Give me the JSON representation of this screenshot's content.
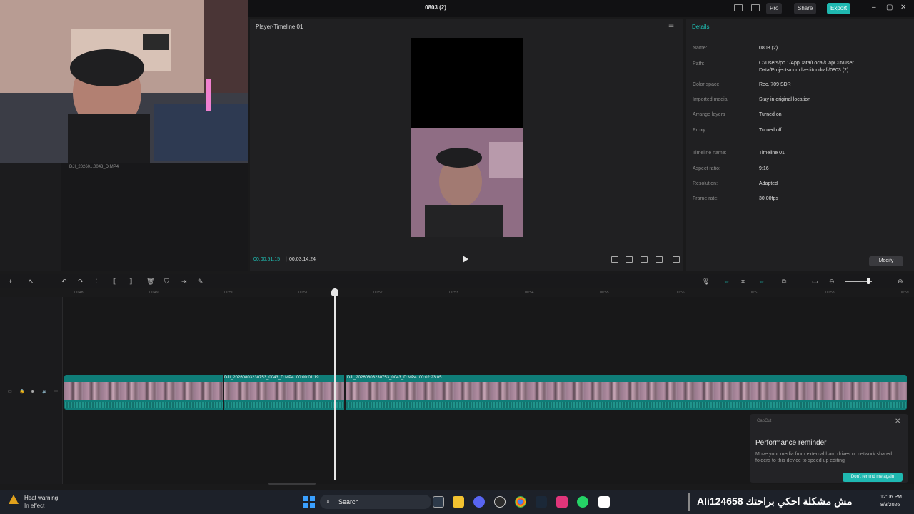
{
  "window": {
    "title": "0803 (2)",
    "pro_label": "Pro",
    "share_label": "Share",
    "export_label": "Export",
    "minimize": "–",
    "maximize": "▢",
    "close": "✕"
  },
  "media": {
    "filename": "DJI_20260...0043_D.MP4"
  },
  "player": {
    "title": "Player-Timeline 01",
    "time_current": "00:00:51:15",
    "time_separator": "|",
    "time_total": "00:03:14:24"
  },
  "details": {
    "title": "Details",
    "rows": [
      {
        "label": "Name:",
        "value": "0803 (2)"
      },
      {
        "label": "Path:",
        "value": "C:/Users/pc 1/AppData/Local/CapCut/User Data/Projects/com.lveditor.draft/0803 (2)"
      },
      {
        "label": "Color space",
        "value": "Rec. 709 SDR"
      },
      {
        "label": "Imported media:",
        "value": "Stay in original location"
      },
      {
        "label": "Arrange layers",
        "value": "Turned on"
      },
      {
        "label": "Proxy:",
        "value": "Turned off"
      },
      {
        "label": "Timeline name:",
        "value": "Timeline 01"
      },
      {
        "label": "Aspect ratio:",
        "value": "9:16"
      },
      {
        "label": "Resolution:",
        "value": "Adapted"
      },
      {
        "label": "Frame rate:",
        "value": "30.00fps"
      }
    ],
    "modify_label": "Modify"
  },
  "timeline": {
    "ruler_ticks": [
      "00:48",
      "00:49",
      "00:50",
      "00:51",
      "00:52",
      "00:53",
      "00:54",
      "00:55",
      "00:56",
      "00:57",
      "00:58",
      "00:59"
    ],
    "clips": [
      {
        "name": "DJI_20260803230753_0043_D.MP4",
        "duration": "00:00:01:19"
      },
      {
        "name": "DJI_20260803230753_0043_D.MP4",
        "duration": "00:02:23:05"
      }
    ]
  },
  "performance_reminder": {
    "brand": "CapCut",
    "title": "Performance reminder",
    "body": "Move your media from external hard drives or network shared folders to this device to speed up editing",
    "button": "Don't remind me again"
  },
  "taskbar": {
    "warning_title": "Heat warning",
    "warning_sub": "In effect",
    "search_label": "Search",
    "overlay_text": "Ali124658 مش مشكلة احكي براحتك",
    "time": "12:06 PM",
    "date": "8/3/2026"
  },
  "colors": {
    "accent": "#1fc3b8",
    "clip": "#0f7d78",
    "background": "#1a1a1b"
  }
}
